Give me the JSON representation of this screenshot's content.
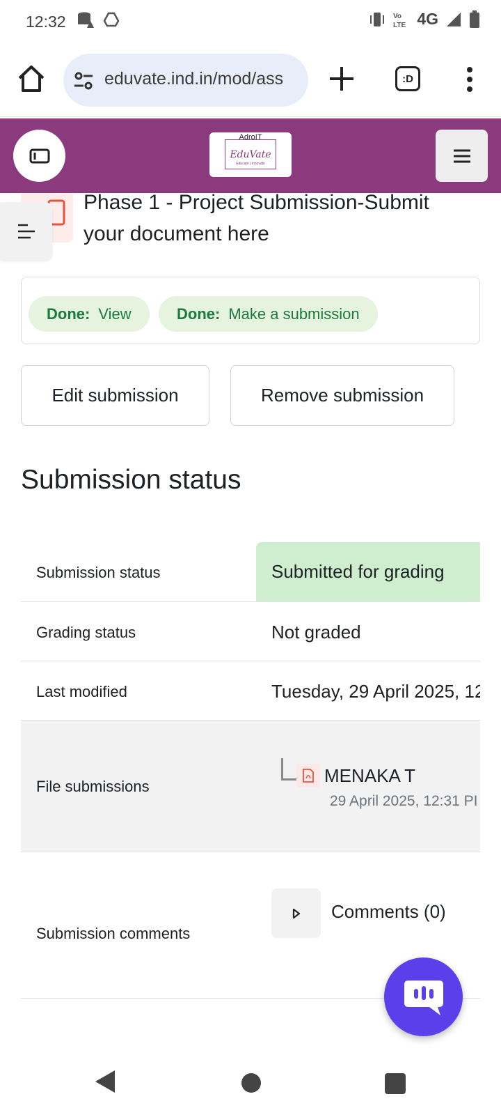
{
  "statusbar": {
    "time": "12:32",
    "network": "4G"
  },
  "browser": {
    "url": "eduvate.ind.in/mod/ass",
    "tabs_label": ":D"
  },
  "header": {
    "logo_top": "AdroIT",
    "logo_brand": "EduVate",
    "logo_tagline": "Educate | Innovate"
  },
  "page": {
    "title": "Phase 1 - Project Submission-Submit your document here"
  },
  "completion": [
    {
      "key": "Done:",
      "value": "View"
    },
    {
      "key": "Done:",
      "value": "Make a submission"
    }
  ],
  "actions": {
    "edit": "Edit submission",
    "remove": "Remove submission"
  },
  "section_title": "Submission status",
  "status_table": {
    "submission_status_label": "Submission status",
    "submission_status_value": "Submitted for grading",
    "grading_status_label": "Grading status",
    "grading_status_value": "Not graded",
    "last_modified_label": "Last modified",
    "last_modified_value": "Tuesday, 29 April 2025, 12",
    "file_submissions_label": "File submissions",
    "file_name": "MENAKA T",
    "file_date": "29 April 2025, 12:31 PI",
    "comments_label": "Submission comments",
    "comments_value": "Comments (0)"
  },
  "colors": {
    "brand": "#8b3a7e",
    "success_bg": "#cfeecf",
    "chat": "#5b3fea"
  }
}
